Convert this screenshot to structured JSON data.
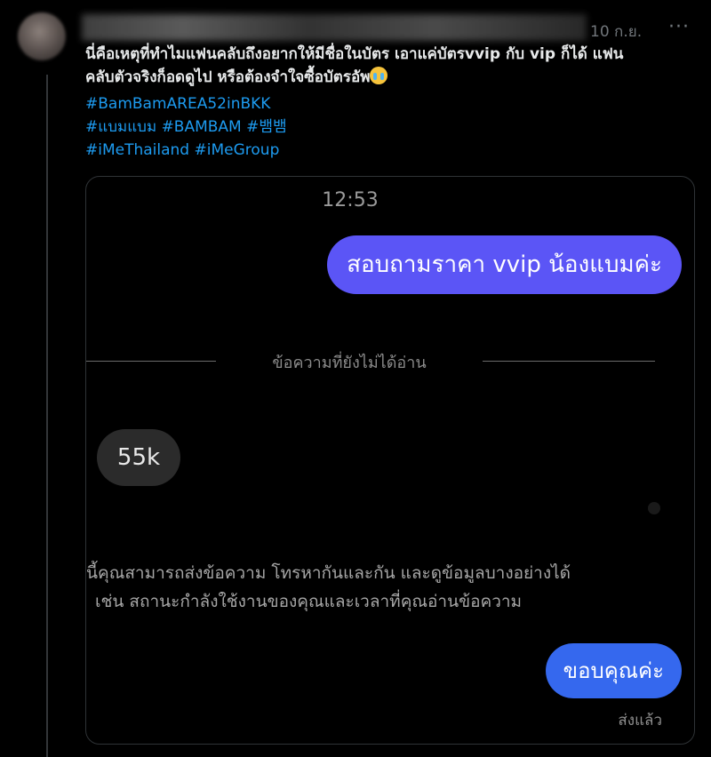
{
  "tweet": {
    "date": "10 ก.ย.",
    "more_label": "···",
    "text_lines": [
      "นี่คือเหตุที่ทำไมแฟนคลับถึงอยากให้มีชื่อในบัตร เอาแค่บัตรvvip กับ vip ก็ได้ แฟน",
      "คลับตัวจริงก็อดดูไป หรือต้องจำใจซื้อบัตรอัพ"
    ],
    "emoji": "loudly-crying-face",
    "hashtag_lines": [
      [
        "#BamBamAREA52inBKK"
      ],
      [
        "#แบมแบม",
        "#BAMBAM",
        "#뱀뱀"
      ],
      [
        "#iMeThailand",
        "#iMeGroup"
      ]
    ]
  },
  "chat": {
    "time": "12:53",
    "outgoing_message": "สอบถามราคา vvip น้องแบมค่ะ",
    "unread_divider": "ข้อความที่ยังไม่ได้อ่าน",
    "incoming_message": "55k",
    "notice_lines": [
      "นี้คุณสามารถส่งข้อความ โทรหากันและกัน และดูข้อมูลบางอย่างได้",
      "เช่น สถานะกำลังใช้งานของคุณและเวลาที่คุณอ่านข้อความ"
    ],
    "thanks_message": "ขอบคุณค่ะ",
    "sent_status": "ส่งแล้ว"
  },
  "colors": {
    "background": "#000000",
    "hashtag": "#1d9bf0",
    "outgoing_bubble": "#5b55f6",
    "thanks_bubble": "#3568ee",
    "incoming_bubble": "#2b2b2b"
  }
}
